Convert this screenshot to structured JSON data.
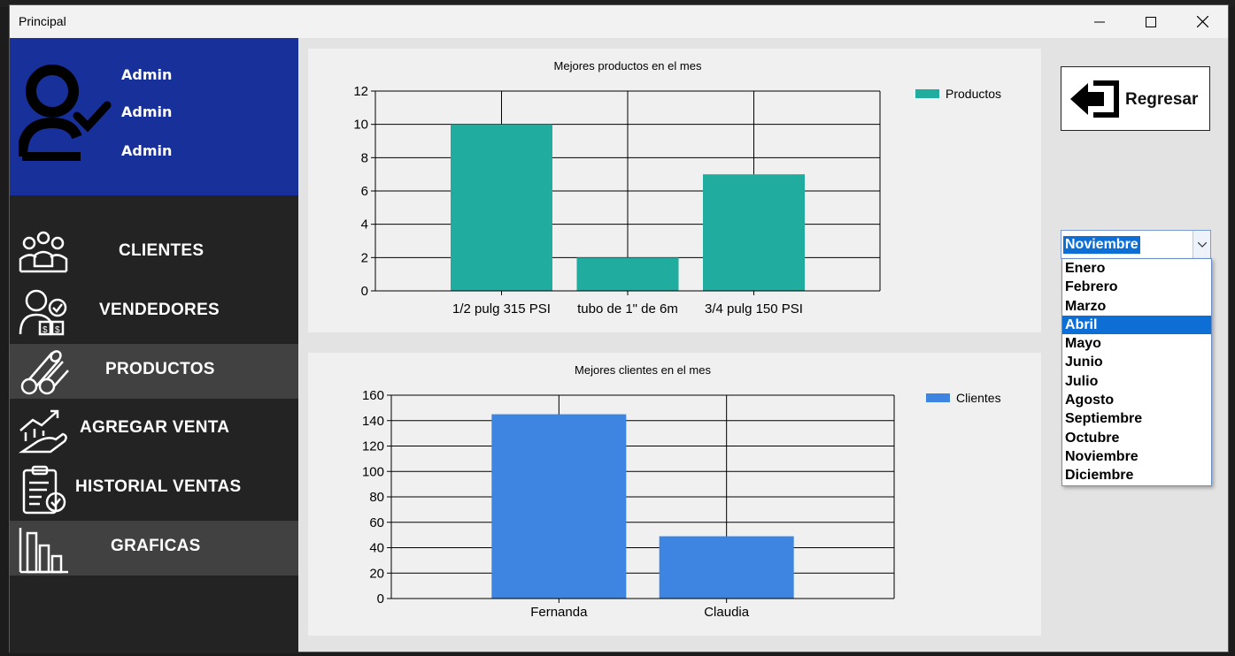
{
  "window": {
    "title": "Principal"
  },
  "profile": {
    "line1": "Admin",
    "line2": "Admin",
    "line3": "Admin"
  },
  "menu": [
    {
      "label": "CLIENTES"
    },
    {
      "label": "VENDEDORES"
    },
    {
      "label": "PRODUCTOS"
    },
    {
      "label": "AGREGAR VENTA"
    },
    {
      "label": "HISTORIAL VENTAS"
    },
    {
      "label": "GRAFICAS"
    }
  ],
  "back_button": {
    "label": "Regresar"
  },
  "month_select": {
    "selected": "Noviembre",
    "options": [
      "Enero",
      "Febrero",
      "Marzo",
      "Abril",
      "Mayo",
      "Junio",
      "Julio",
      "Agosto",
      "Septiembre",
      "Octubre",
      "Noviembre",
      "Diciembre"
    ],
    "highlighted": "Abril"
  },
  "colors": {
    "profile_bg": "#18309a",
    "sidebar_bg": "#232323",
    "products": "#20ad9f",
    "clients": "#3d85e0",
    "highlight": "#0d6fd6"
  },
  "chart_data": [
    {
      "type": "bar",
      "title": "Mejores productos en el mes",
      "categories": [
        "1/2 pulg 315 PSI",
        "tubo de 1\" de 6m",
        "3/4 pulg 150 PSI"
      ],
      "series": [
        {
          "name": "Productos",
          "values": [
            10,
            2,
            7
          ]
        }
      ],
      "ylim": [
        0,
        12
      ],
      "yticks": [
        0,
        2,
        4,
        6,
        8,
        10,
        12
      ],
      "grid": true,
      "legend": "top-right"
    },
    {
      "type": "bar",
      "title": "Mejores clientes en el mes",
      "categories": [
        "Fernanda",
        "Claudia"
      ],
      "series": [
        {
          "name": "Clientes",
          "values": [
            145,
            49
          ]
        }
      ],
      "ylim": [
        0,
        160
      ],
      "yticks": [
        0,
        20,
        40,
        60,
        80,
        100,
        120,
        140,
        160
      ],
      "grid": true,
      "legend": "top-right"
    }
  ]
}
